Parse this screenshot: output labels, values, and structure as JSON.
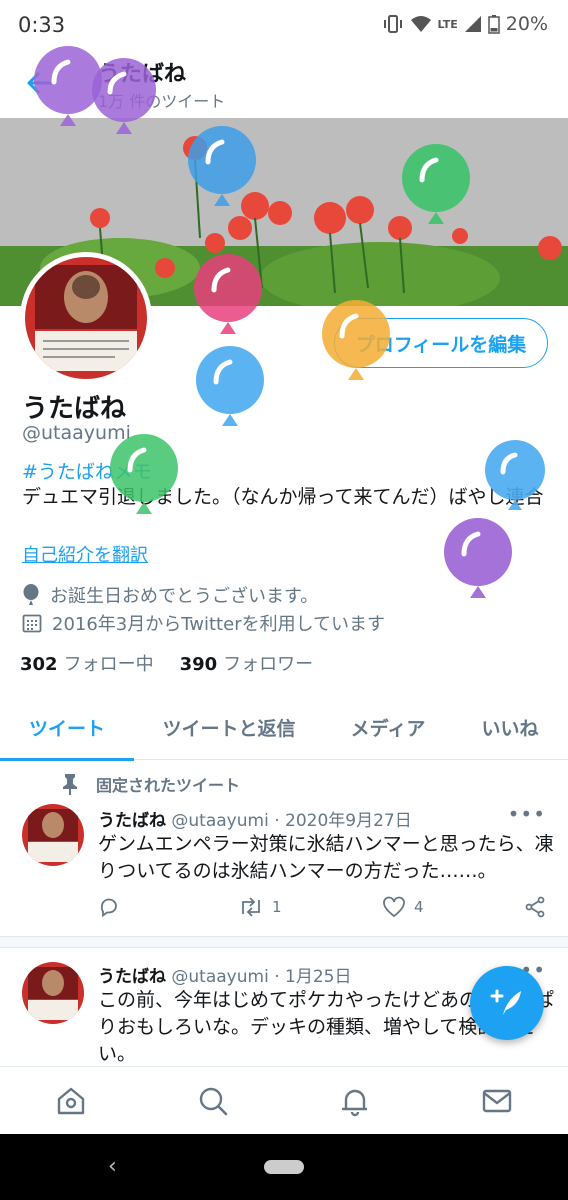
{
  "status": {
    "time": "0:33",
    "lte": "LTE",
    "battery": "20%"
  },
  "header": {
    "title": "うたばね",
    "subtitle": "1万 件のツイート"
  },
  "profile": {
    "name": "うたばね",
    "handle": "@utaayumi",
    "edit_label": "プロフィールを編集",
    "bio_hashtag": "#うたばねメモ",
    "bio_text": "デュエマ引退しました。（なんか帰って来てんだ）ばやし連合",
    "translate_label": "自己紹介を翻訳",
    "birthday": "お誕生日おめでとうございます。",
    "joined": "2016年3月からTwitterを利用しています",
    "following_count": "302",
    "following_label": "フォロー中",
    "followers_count": "390",
    "followers_label": "フォロワー"
  },
  "tabs": [
    {
      "label": "ツイート"
    },
    {
      "label": "ツイートと返信"
    },
    {
      "label": "メディア"
    },
    {
      "label": "いいね"
    }
  ],
  "pinned_label": "固定されたツイート",
  "tweets": [
    {
      "name": "うたばね",
      "handle": "@utaayumi",
      "date": "2020年9月27日",
      "text": "ゲンムエンペラー対策に氷結ハンマーと思ったら、凍りついてるのは氷結ハンマーの方だった……。",
      "retweets": "1",
      "likes": "4"
    },
    {
      "name": "うたばね",
      "handle": "@utaayumi",
      "date": "1月25日",
      "text": "この前、今年はじめてポケカやったけどあの、やっぱりおもしろいな。デッキの種類、増やして検討したい。"
    }
  ],
  "colors": {
    "accent": "#1da1f2",
    "secondary_text": "#657786"
  }
}
